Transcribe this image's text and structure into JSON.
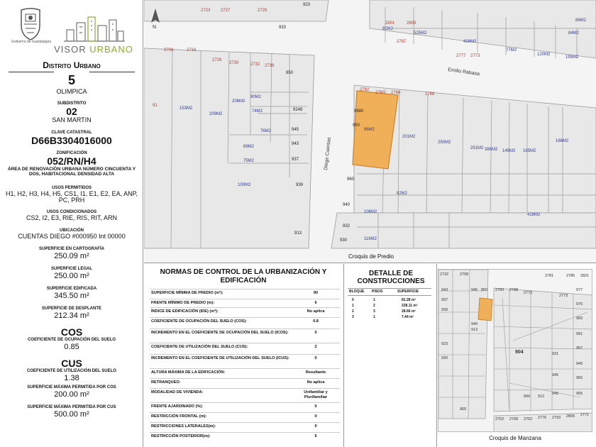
{
  "logo": {
    "seal_label": "Gobierno de Guadalajara",
    "brand_a": "VISOR",
    "brand_b": "URBANO"
  },
  "distrito": {
    "title": "Distrito Urbano",
    "number": "5",
    "name": "OLIMPICA"
  },
  "subdistrito": {
    "label": "SUBDISTRITO",
    "number": "02",
    "name": "SAN MARTIN"
  },
  "clave": {
    "label": "CLAVE CATASTRAL",
    "value": "D66B3304016000"
  },
  "zonificacion": {
    "label": "ZONIFICACIÓN",
    "value": "052/RN/H4",
    "desc": "ÁREA DE RENOVACIÓN URBANA NÚMERO CINCUENTA Y DOS, HABITACIONAL DENSIDAD ALTA"
  },
  "usos_permitidos": {
    "label": "USOS PERMITIDOS",
    "value": "H1, H2, H3, H4, H5, CS1, I1, E1, E2, EA, ANP, PC, PRH"
  },
  "usos_condicionados": {
    "label": "USOS CONDICIONADOS",
    "value": "CS2, I2, E3, RIE, RIS, RIT, ARN"
  },
  "ubicacion": {
    "label": "UBICACIÓN",
    "value": "CUENTAS DIEGO #000950 Int 00000"
  },
  "superficies": [
    {
      "label": "SUPERFICIE EN CARTOGRAFÍA",
      "value": "250.09 m²"
    },
    {
      "label": "SUPERFICIE LEGAL",
      "value": "250.00 m²"
    },
    {
      "label": "SUPERFICIE EDIFICADA",
      "value": "345.50 m²"
    },
    {
      "label": "SUPERFICIE DE DESPLANTE",
      "value": "212.34 m²"
    }
  ],
  "cos": {
    "title": "COS",
    "label": "COEFICIENTE DE OCUPACIÓN DEL SUELO",
    "value": "0.85"
  },
  "cus": {
    "title": "CUS",
    "label": "COEFICIENTE DE UTILIZACIÓN DEL SUELO",
    "value": "1.38"
  },
  "max_cos": {
    "label": "SUPERFICIE MÁXIMA PERMITIDA POR COS",
    "value": "200.00 m²"
  },
  "max_cus": {
    "label": "SUPERFICIE MÁXIMA PERMITIDA POR CUS",
    "value": "500.00 m²"
  },
  "map": {
    "caption": "Croquis de Predio",
    "streets": [
      "Emilio Rabasa",
      "Diego Cuentas"
    ],
    "labels": [
      "2723",
      "2727",
      "2729",
      "933",
      "2801",
      "2805",
      "2787",
      "2777",
      "2773",
      "2708",
      "2716",
      "2726",
      "2730",
      "2732",
      "2738",
      "850",
      "2782",
      "2760",
      "2768",
      "2788",
      "9680",
      "950",
      "960",
      "940",
      "932",
      "930",
      "9248",
      "945",
      "943",
      "937",
      "939",
      "913",
      "923",
      "91",
      "153M2",
      "209M2",
      "206M2",
      "90M2",
      "74M2",
      "76M2",
      "69M2",
      "75M2",
      "100M2",
      "96M2",
      "201M2",
      "250M2",
      "251M2",
      "388M2",
      "146M2",
      "185M2",
      "166M2",
      "106M2",
      "82M2",
      "118M2",
      "418M2",
      "82M2",
      "525M2",
      "428M2",
      "77M2",
      "120M2",
      "195M2",
      "84M2",
      "86M2",
      "76M2",
      "201M2",
      "93M2"
    ]
  },
  "norms": {
    "title": "NORMAS DE CONTROL DE LA URBANIZACIÓN Y EDIFICACIÓN",
    "rows": [
      {
        "k": "SUPERFICIE MÍNIMA DE PREDIO (m²):",
        "v": "90"
      },
      {
        "k": "FRENTE MÍNIMO DE PREDIO (m):",
        "v": "6"
      },
      {
        "k": "ÍNDICE DE EDIFICACIÓN (IDE) (m²):",
        "v": "No aplica"
      },
      {
        "k": "COEFICIENTE DE OCUPACIÓN DEL SUELO (COS):",
        "v": "0.8"
      },
      {
        "k": "INCREMENTO EN EL COEFICIENTE DE OCUPACIÓN DEL SUELO (ICOS):",
        "v": "0"
      },
      {
        "k": "COEFICIENTE DE UTILIZACIÓN DEL SUELO (CUS):",
        "v": "2"
      },
      {
        "k": "INCREMENTO EN EL COEFICIENTE DE UTILIZACIÓN DEL SUELO (ICUS):",
        "v": "0"
      },
      {
        "k": "ALTURA MÁXIMA DE LA EDIFICACIÓN:",
        "v": "Resultante"
      },
      {
        "k": "RETRANQUEO:",
        "v": "No aplica"
      },
      {
        "k": "MODALIDAD DE VIVIENDA:",
        "v": "Unifamiliar y Plurifamiliar"
      },
      {
        "k": "FRENTE AJARDINADO (%):",
        "v": "0"
      },
      {
        "k": "RESTRICCIÓN FRONTAL (m):",
        "v": "0"
      },
      {
        "k": "RESTRICCIONES LATERALES(m):",
        "v": "0"
      },
      {
        "k": "RESTRICCIÓN POSTERIOR(m):",
        "v": "6"
      }
    ]
  },
  "construcciones": {
    "title": "DETALLE DE CONSTRUCCIONES",
    "headers": [
      "BLOQUE",
      "PISOS",
      "SUPERFICIE"
    ],
    "rows": [
      [
        "0",
        "1",
        "81.28 m²"
      ],
      [
        "1",
        "2",
        "228.11 m²"
      ],
      [
        "2",
        "3",
        "28.66 m²"
      ],
      [
        "3",
        "1",
        "7.44 m²"
      ]
    ]
  },
  "manzana": {
    "caption": "Croquis de Manzana",
    "labels": [
      "2732",
      "2708",
      "943",
      "937",
      "939",
      "923",
      "930",
      "945",
      "913",
      "940",
      "904",
      "977",
      "975",
      "983",
      "991",
      "957",
      "949",
      "955",
      "931",
      "945",
      "965",
      "945",
      "965",
      "2752",
      "2768",
      "2762",
      "2776",
      "2793",
      "2805",
      "2771",
      "2781",
      "2785",
      "2821",
      "2788",
      "2760",
      "850",
      "2773",
      "2773",
      "900",
      "912"
    ]
  },
  "colors": {
    "highlight": "#f0b05a",
    "highlight_stroke": "#c9832b",
    "parcel_fill": "#e8e8e8",
    "street": "#ffffff",
    "lot_line": "#9a9a9a",
    "lot_number": "#c0392b",
    "area_text": "#2b3aa8",
    "brand_green": "#8aae2e"
  }
}
